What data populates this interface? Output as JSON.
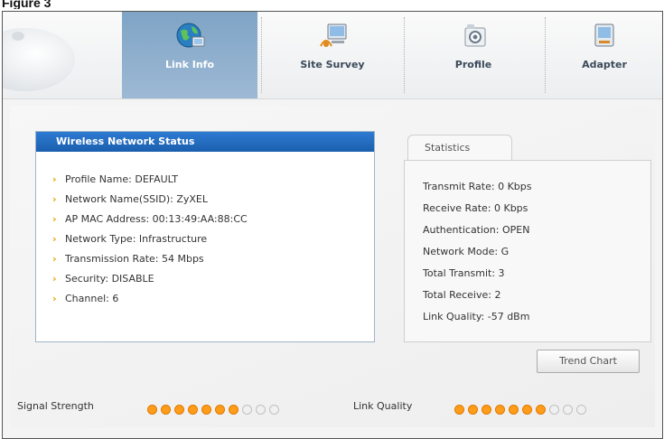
{
  "figure_label": "Figure 3",
  "nav": {
    "tabs": [
      {
        "label": "Link Info",
        "icon": "globe-icon"
      },
      {
        "label": "Site Survey",
        "icon": "site-survey-icon"
      },
      {
        "label": "Profile",
        "icon": "profile-icon"
      },
      {
        "label": "Adapter",
        "icon": "adapter-icon"
      }
    ]
  },
  "status_panel": {
    "title": "Wireless Network Status",
    "items": [
      "Profile Name: DEFAULT",
      "Network Name(SSID): ZyXEL",
      "AP MAC Address: 00:13:49:AA:88:CC",
      "Network Type: Infrastructure",
      "Transmission Rate: 54 Mbps",
      "Security: DISABLE",
      "Channel: 6"
    ]
  },
  "statistics": {
    "tab_label": "Statistics",
    "items": [
      "Transmit Rate: 0 Kbps",
      "Receive Rate: 0 Kbps",
      "Authentication: OPEN",
      "Network Mode: G",
      "Total Transmit: 3",
      "Total Receive: 2",
      "Link Quality: -57 dBm"
    ],
    "trend_button": "Trend Chart"
  },
  "meters": {
    "signal_strength": {
      "label": "Signal Strength",
      "level": 7,
      "max": 10
    },
    "link_quality": {
      "label": "Link Quality",
      "level": 7,
      "max": 10
    }
  },
  "colors": {
    "accent_blue": "#1b5fae",
    "meter_on": "#ff9c1a",
    "bullet": "#e8a200"
  }
}
